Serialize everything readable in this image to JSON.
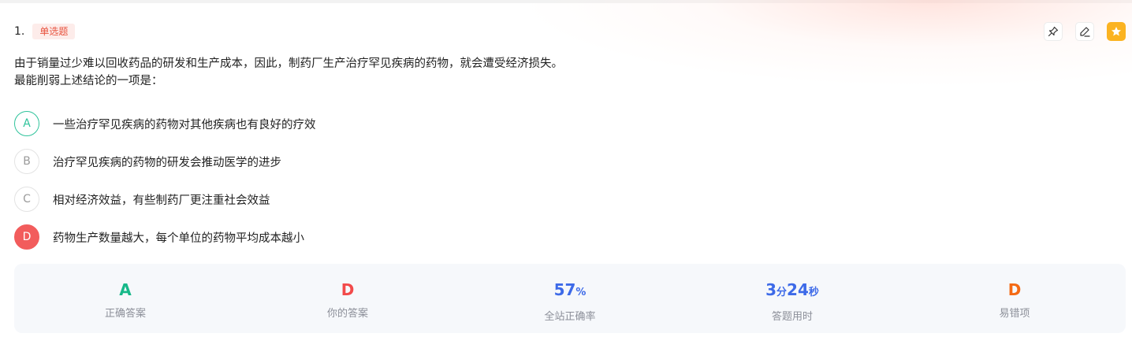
{
  "question": {
    "number": "1.",
    "type_badge": "单选题",
    "stem_line1": "由于销量过少难以回收药品的研发和生产成本，因此，制药厂生产治疗罕见疾病的药物，就会遭受经济损失。",
    "stem_line2": "最能削弱上述结论的一项是："
  },
  "toolbar": {
    "icons": [
      "pin-icon",
      "edit-icon",
      "star-icon"
    ]
  },
  "options": [
    {
      "letter": "A",
      "text": "一些治疗罕见疾病的药物对其他疾病也有良好的疗效",
      "state": "correct"
    },
    {
      "letter": "B",
      "text": "治疗罕见疾病的药物的研发会推动医学的进步",
      "state": "normal"
    },
    {
      "letter": "C",
      "text": "相对经济效益，有些制药厂更注重社会效益",
      "state": "normal"
    },
    {
      "letter": "D",
      "text": "药物生产数量越大，每个单位的药物平均成本越小",
      "state": "wrong"
    }
  ],
  "stats": {
    "correct_answer": {
      "value": "A",
      "label": "正确答案",
      "color": "#17b889"
    },
    "your_answer": {
      "value": "D",
      "label": "你的答案",
      "color": "#f24a4a"
    },
    "accuracy": {
      "value": "57",
      "unit": "%",
      "label": "全站正确率",
      "color": "#3d6ae8"
    },
    "time": {
      "minutes": "3",
      "min_unit": "分",
      "seconds": "24",
      "sec_unit": "秒",
      "label": "答题用时",
      "color": "#3d6ae8"
    },
    "error_prone": {
      "value": "D",
      "label": "易错项",
      "color": "#f46a14"
    }
  }
}
